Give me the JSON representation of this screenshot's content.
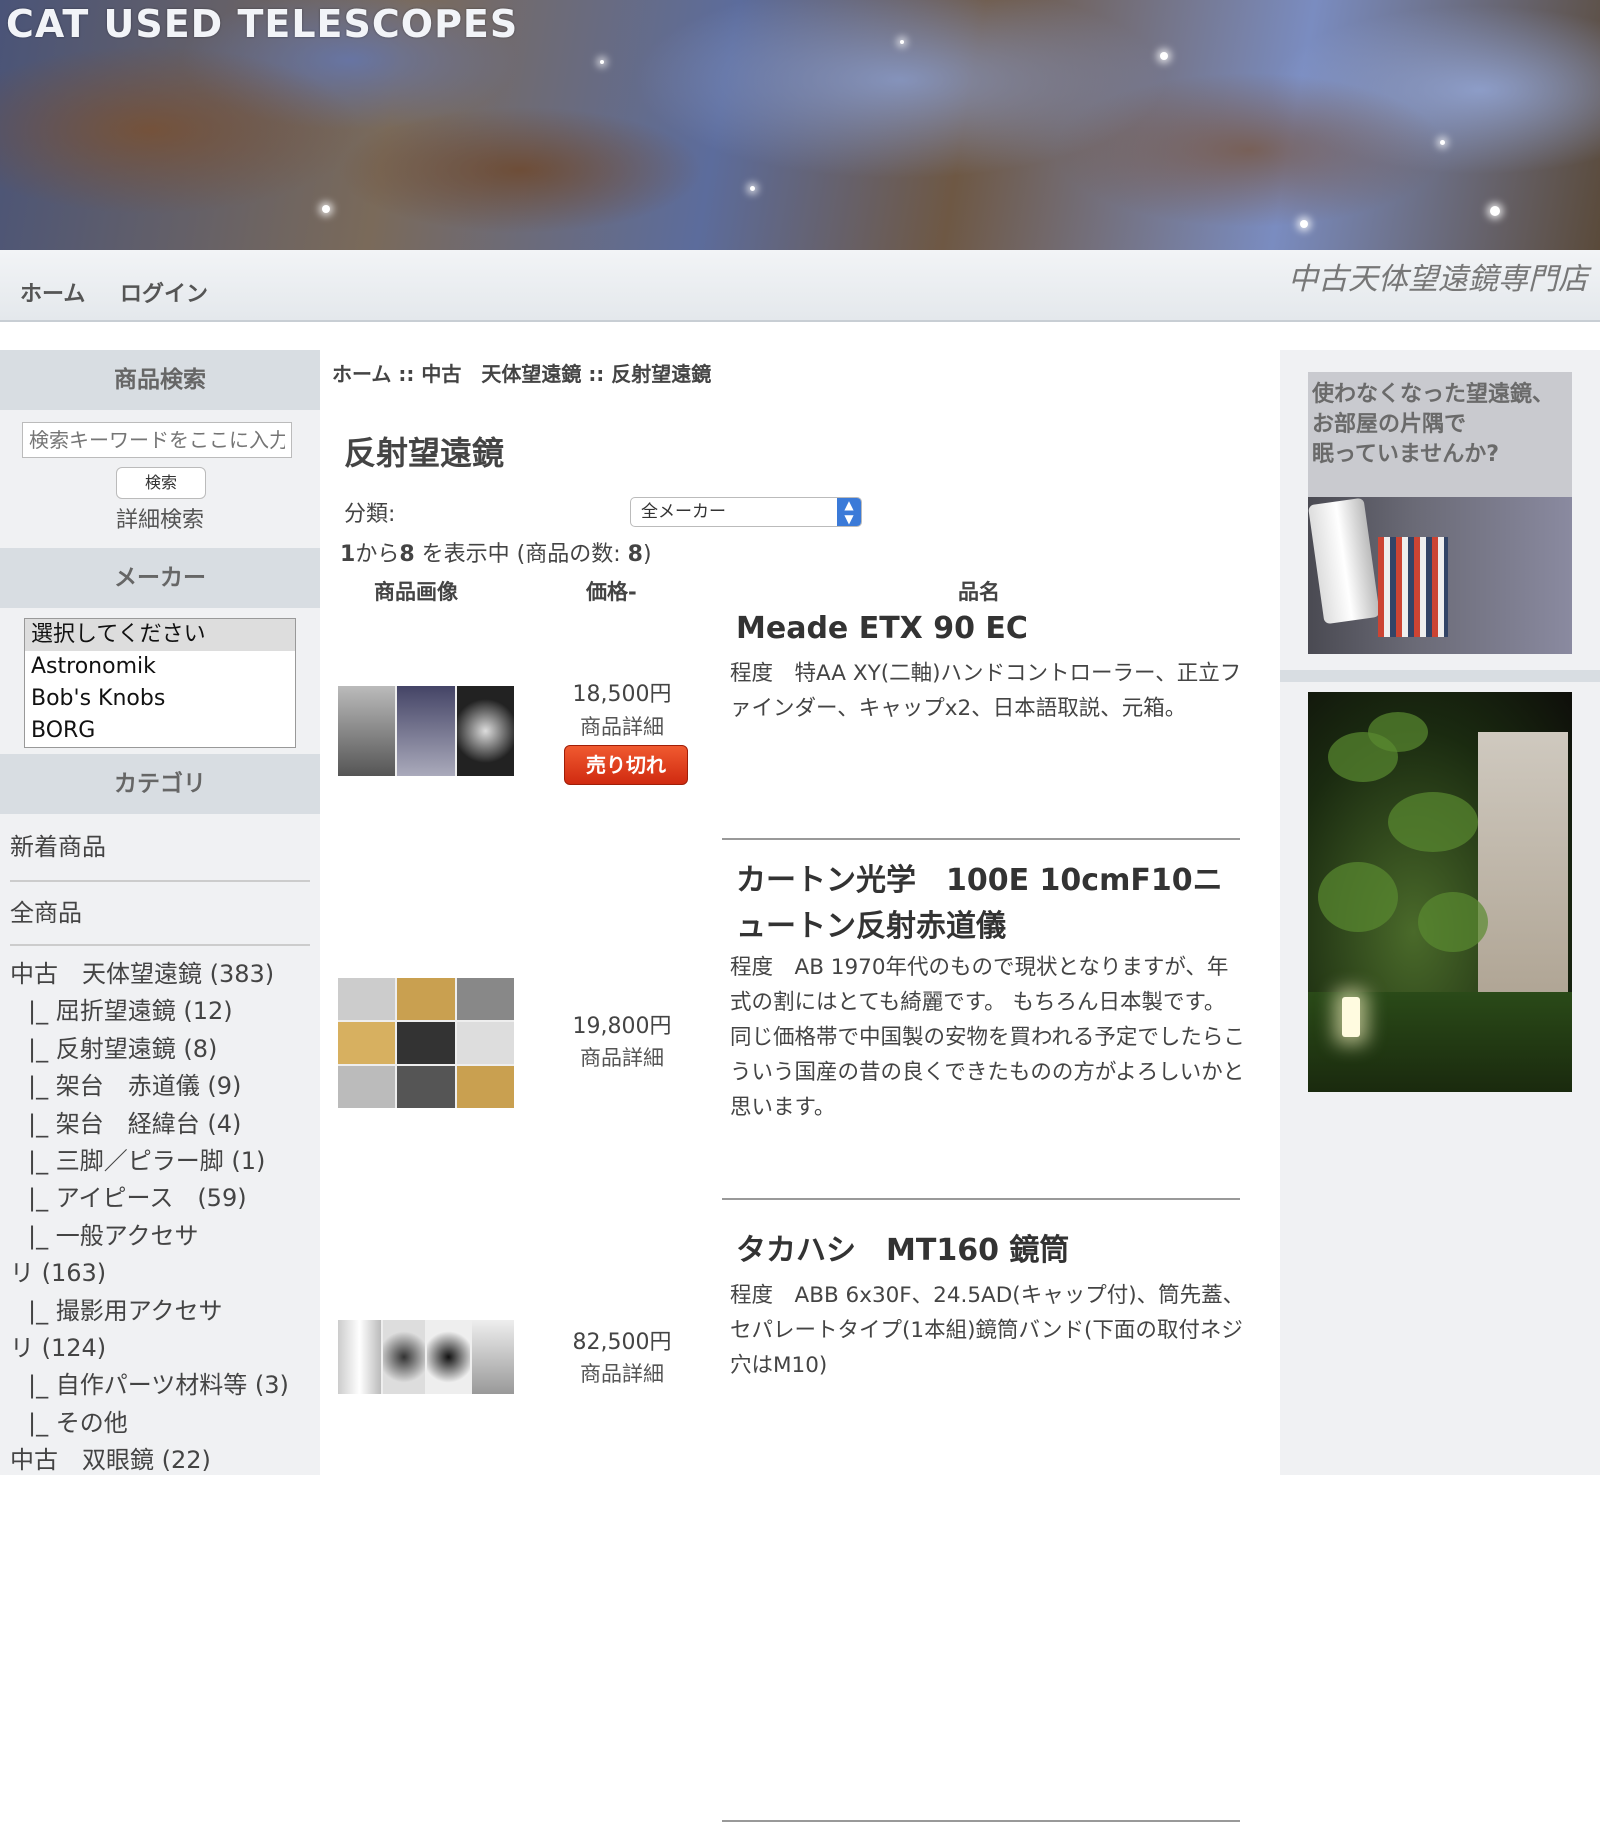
{
  "header": {
    "site_title": "CAT USED TELESCOPES",
    "tagline": "中古天体望遠鏡専門店",
    "nav": [
      "ホーム",
      "ログイン"
    ]
  },
  "sidebar": {
    "search": {
      "heading": "商品検索",
      "placeholder": "検索キーワードをここに入力",
      "button": "検索",
      "advanced": "詳細検索"
    },
    "maker": {
      "heading": "メーカー",
      "options": [
        "選択してください",
        "Astronomik",
        "Bob's Knobs",
        "BORG"
      ]
    },
    "category": {
      "heading": "カテゴリ",
      "top_items": [
        "新着商品",
        "全商品"
      ],
      "tree": [
        {
          "label": "中古　天体望遠鏡 (383)",
          "level": 0
        },
        {
          "label": "|_ 屈折望遠鏡 (12)",
          "level": 1
        },
        {
          "label": "|_ 反射望遠鏡 (8)",
          "level": 1
        },
        {
          "label": "|_ 架台　赤道儀 (9)",
          "level": 1
        },
        {
          "label": "|_ 架台　経緯台 (4)",
          "level": 1
        },
        {
          "label": "|_ 三脚／ピラー脚 (1)",
          "level": 1
        },
        {
          "label": "|_ アイピース　(59)",
          "level": 1
        },
        {
          "label": "|_ 一般アクセサ",
          "level": 1
        },
        {
          "label": "リ (163)",
          "level": 0
        },
        {
          "label": "|_ 撮影用アクセサ",
          "level": 1
        },
        {
          "label": "リ (124)",
          "level": 0
        },
        {
          "label": "|_ 自作パーツ材料等 (3)",
          "level": 1
        },
        {
          "label": "|_ その他",
          "level": 1
        },
        {
          "label": "中古　双眼鏡 (22)",
          "level": 0
        }
      ]
    }
  },
  "main": {
    "breadcrumb": [
      "ホーム",
      "中古　天体望遠鏡",
      "反射望遠鏡"
    ],
    "breadcrumb_sep": "::",
    "title": "反射望遠鏡",
    "filter_label": "分類:",
    "filter_value": "全メーカー",
    "count": {
      "from": "1",
      "mid": "から",
      "to": "8",
      "rest": " を表示中 (商品の数: ",
      "total": "8",
      "end": ")"
    },
    "columns": {
      "image": "商品画像",
      "price": "価格-",
      "name": "品名"
    },
    "detail_label": "商品詳細",
    "soldout_label": "売り切れ",
    "products": [
      {
        "name": "Meade ETX 90 EC",
        "price": "18,500円",
        "sold_out": true,
        "desc": "程度　特AA XY(二軸)ハンドコントローラー、正立ファインダー、キャップx2、日本語取説、元箱。"
      },
      {
        "name": "カートン光学　100E 10cmF10ニュートン反射赤道儀",
        "price": "19,800円",
        "sold_out": false,
        "desc": "程度　AB 1970年代のもので現状となりますが、年式の割にはとても綺麗です。 もちろん日本製です。　同じ価格帯で中国製の安物を買われる予定でしたらこういう国産の昔の良くできたものの方がよろしいかと思います。"
      },
      {
        "name": "タカハシ　MT160 鏡筒",
        "price": "82,500円",
        "sold_out": false,
        "desc": "程度　ABB 6x30F、24.5AD(キャップ付)、筒先蓋、セパレートタイプ(1本組)鏡筒バンド(下面の取付ネジ穴はM10)"
      }
    ]
  },
  "right": {
    "ad_text": "使わなくなった望遠鏡、\nお部屋の片隅で\n眠っていませんか?"
  }
}
